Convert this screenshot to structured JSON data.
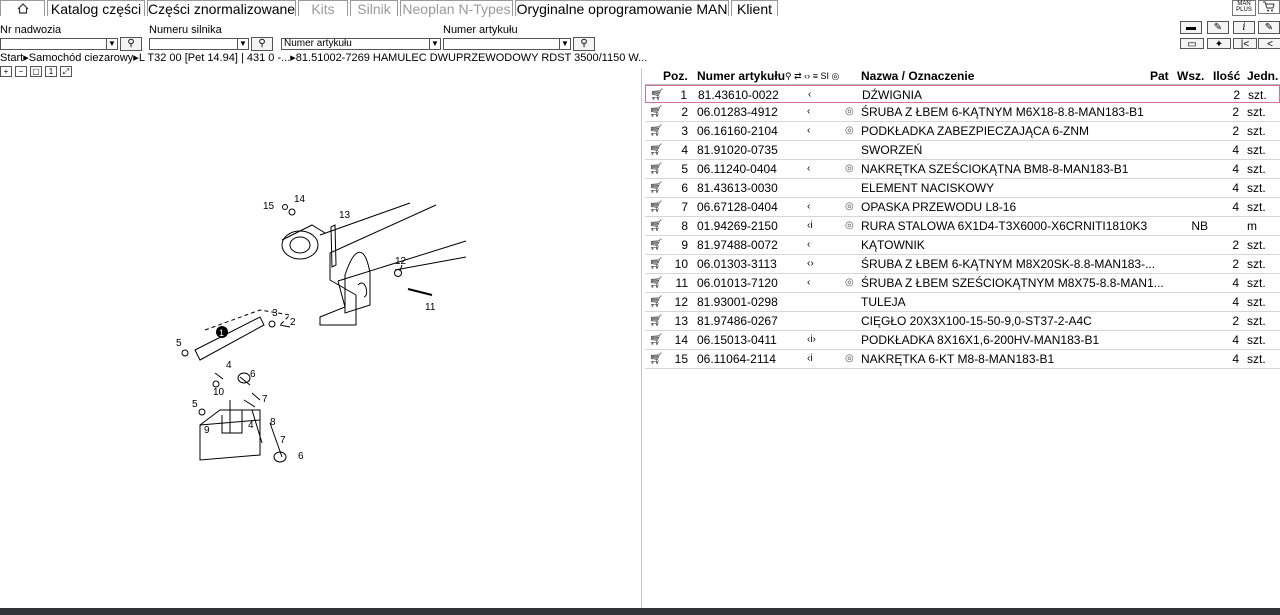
{
  "tabs": [
    {
      "label": "Katalog części",
      "active": true,
      "disabled": false
    },
    {
      "label": "Części znormalizowane",
      "active": false,
      "disabled": false
    },
    {
      "label": "Kits",
      "active": false,
      "disabled": true
    },
    {
      "label": "Silnik",
      "active": false,
      "disabled": true
    },
    {
      "label": "Neoplan N-Types",
      "active": false,
      "disabled": true
    },
    {
      "label": "Oryginalne oprogramowanie MAN",
      "active": false,
      "disabled": false
    },
    {
      "label": "Klient",
      "active": false,
      "disabled": false
    }
  ],
  "home_icon": "home-icon",
  "logo": {
    "line1": "MAN",
    "line2": "PLUS"
  },
  "filters": {
    "chassis_label": "Nr nadwozia",
    "chassis_value": "",
    "engine_label": "Numeru silnika",
    "engine_value": "",
    "article_select_value": "Numer artykułu",
    "article_label": "Numer artykułu",
    "article_value": ""
  },
  "breadcrumb": "Start▸Samochód ciezarowy▸L T32 00  [Pet 14.94]  | 431 0 -...▸81.51002-7269  HAMULEC DWUPRZEWODOWY RDST 3500/1150 W...",
  "table": {
    "headers": {
      "pos": "Poz.",
      "article": "Numer artykułu",
      "si": "SI",
      "name": "Nazwa / Oznaczenie",
      "pat": "Pat",
      "wsz": "Wsz.",
      "qty": "Ilość",
      "unit": "Jedn."
    },
    "rows": [
      {
        "pos": "1",
        "article": "81.43610-0022",
        "mark": "‹",
        "circle": false,
        "name": "DŹWIGNIA",
        "wsz": "",
        "qty": "2",
        "unit": "szt."
      },
      {
        "pos": "2",
        "article": "06.01283-4912",
        "mark": "‹",
        "circle": true,
        "name": "ŚRUBA Z ŁBEM 6-KĄTNYM  M6X18-8.8-MAN183-B1",
        "wsz": "",
        "qty": "2",
        "unit": "szt."
      },
      {
        "pos": "3",
        "article": "06.16160-2104",
        "mark": "‹",
        "circle": true,
        "name": "PODKŁADKA ZABEZPIECZAJĄCA  6-ZNM",
        "wsz": "",
        "qty": "2",
        "unit": "szt."
      },
      {
        "pos": "4",
        "article": "81.91020-0735",
        "mark": "",
        "circle": false,
        "name": "SWORZEŃ",
        "wsz": "",
        "qty": "4",
        "unit": "szt."
      },
      {
        "pos": "5",
        "article": "06.11240-0404",
        "mark": "‹",
        "circle": true,
        "name": "NAKRĘTKA SZEŚCIOKĄTNA  BM8-8-MAN183-B1",
        "wsz": "",
        "qty": "4",
        "unit": "szt."
      },
      {
        "pos": "6",
        "article": "81.43613-0030",
        "mark": "",
        "circle": false,
        "name": "ELEMENT NACISKOWY",
        "wsz": "",
        "qty": "4",
        "unit": "szt."
      },
      {
        "pos": "7",
        "article": "06.67128-0404",
        "mark": "‹",
        "circle": true,
        "name": "OPASKA PRZEWODU  L8-16",
        "wsz": "",
        "qty": "4",
        "unit": "szt."
      },
      {
        "pos": "8",
        "article": "01.94269-2150",
        "mark": "‹i",
        "circle": true,
        "name": "RURA STALOWA  6X1D4-T3X6000-X6CRNITI1810K3",
        "wsz": "NB",
        "qty": "",
        "unit": "m"
      },
      {
        "pos": "9",
        "article": "81.97488-0072",
        "mark": "‹",
        "circle": false,
        "name": "KĄTOWNIK",
        "wsz": "",
        "qty": "2",
        "unit": "szt."
      },
      {
        "pos": "10",
        "article": "06.01303-3113",
        "mark": "‹›",
        "circle": false,
        "name": "ŚRUBA Z ŁBEM 6-KĄTNYM  M8X20SK-8.8-MAN183-...",
        "wsz": "",
        "qty": "2",
        "unit": "szt."
      },
      {
        "pos": "11",
        "article": "06.01013-7120",
        "mark": "‹",
        "circle": true,
        "name": "ŚRUBA Z ŁBEM SZEŚCIOKĄTNYM  M8X75-8.8-MAN1...",
        "wsz": "",
        "qty": "4",
        "unit": "szt."
      },
      {
        "pos": "12",
        "article": "81.93001-0298",
        "mark": "",
        "circle": false,
        "name": "TULEJA",
        "wsz": "",
        "qty": "4",
        "unit": "szt."
      },
      {
        "pos": "13",
        "article": "81.97486-0267",
        "mark": "",
        "circle": false,
        "name": "CIĘGŁO  20X3X100-15-50-9,0-ST37-2-A4C",
        "wsz": "",
        "qty": "2",
        "unit": "szt."
      },
      {
        "pos": "14",
        "article": "06.15013-0411",
        "mark": "‹i›",
        "circle": false,
        "name": "PODKŁADKA  8X16X1,6-200HV-MAN183-B1",
        "wsz": "",
        "qty": "4",
        "unit": "szt."
      },
      {
        "pos": "15",
        "article": "06.11064-2114",
        "mark": "‹i",
        "circle": true,
        "name": "NAKRĘTKA 6-KT  M8-8-MAN183-B1",
        "wsz": "",
        "qty": "4",
        "unit": "szt."
      }
    ]
  },
  "drawing_labels": [
    "1",
    "2",
    "3",
    "4",
    "4",
    "5",
    "5",
    "6",
    "6",
    "7",
    "7",
    "8",
    "9",
    "10",
    "11",
    "12",
    "13",
    "14",
    "15"
  ]
}
